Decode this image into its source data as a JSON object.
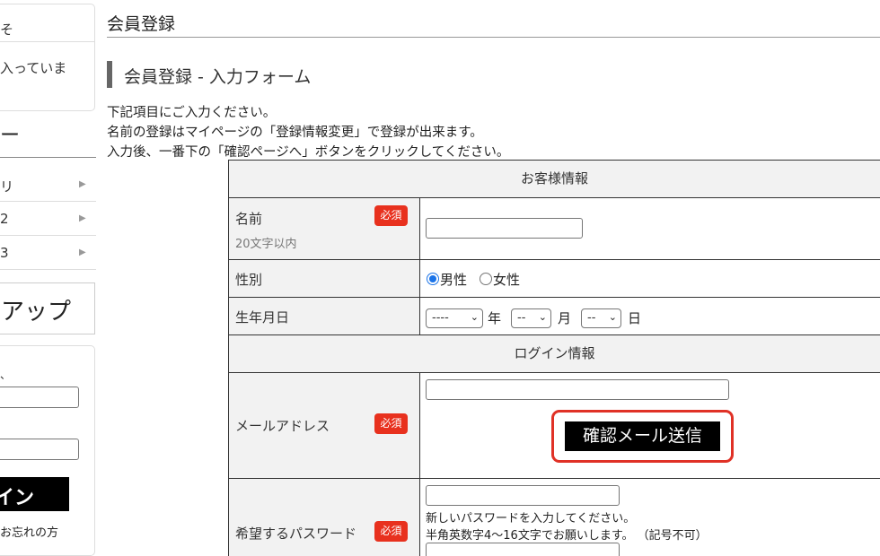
{
  "sidebar": {
    "box_line1": "そ",
    "box_line2": "入っていま",
    "heading": "ー",
    "items": [
      {
        "label": "リ"
      },
      {
        "label": "2"
      },
      {
        "label": "3"
      }
    ],
    "banner": "アップ",
    "login_label": "、",
    "login_button": "イン",
    "forgot": "お忘れの方"
  },
  "page": {
    "title": "会員登録",
    "section_title": "会員登録 - 入力フォーム",
    "intro": [
      "下記項目にご入力ください。",
      "名前の登録はマイページの「登録情報変更」で登録が出来ます。",
      "入力後、一番下の「確認ページへ」ボタンをクリックしてください。"
    ]
  },
  "form": {
    "customer_header": "お客様情報",
    "name_label": "名前",
    "name_hint": "20文字以内",
    "required": "必須",
    "name_value": "",
    "gender_label": "性別",
    "gender_options": [
      "男性",
      "女性"
    ],
    "gender_selected": "男性",
    "birth_label": "生年月日",
    "birth_year": "----",
    "birth_month": "--",
    "birth_day": "--",
    "unit_year": "年",
    "unit_month": "月",
    "unit_day": "日",
    "login_header": "ログイン情報",
    "email_label": "メールアドレス",
    "email_value": "",
    "confirm_email_button": "確認メール送信",
    "password_label": "希望するパスワード",
    "password_note1": "新しいパスワードを入力してください。",
    "password_note2": "半角英数字4～16文字でお願いします。 （記号不可）"
  },
  "colors": {
    "required_badge": "#e8311e",
    "highlight_border": "#e03126",
    "radio_selected": "#1a73e8",
    "label_cell_bg": "#f2f2f2"
  },
  "icons": {
    "sidebar_arrow": "triangle-right",
    "select_chevron": "chevron-down"
  }
}
